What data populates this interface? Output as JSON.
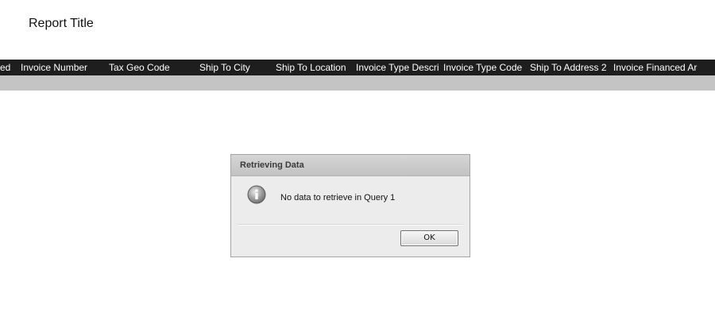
{
  "report": {
    "title": "Report Title"
  },
  "table": {
    "columns": [
      "ed",
      "Invoice Number",
      "Tax Geo Code",
      "Ship To City",
      "Ship To Location",
      "Invoice Type Descri",
      "Invoice Type Code",
      "Ship To Address 2",
      "Invoice Financed Ar"
    ]
  },
  "dialog": {
    "title": "Retrieving Data",
    "icon": "info-icon",
    "message": "No data to retrieve in Query 1",
    "ok_label": "OK"
  },
  "colors": {
    "header_bar": "#1e1e1e",
    "header_text": "#ffffff",
    "band": "#c4c4c4",
    "dialog_bg": "#ececec"
  }
}
